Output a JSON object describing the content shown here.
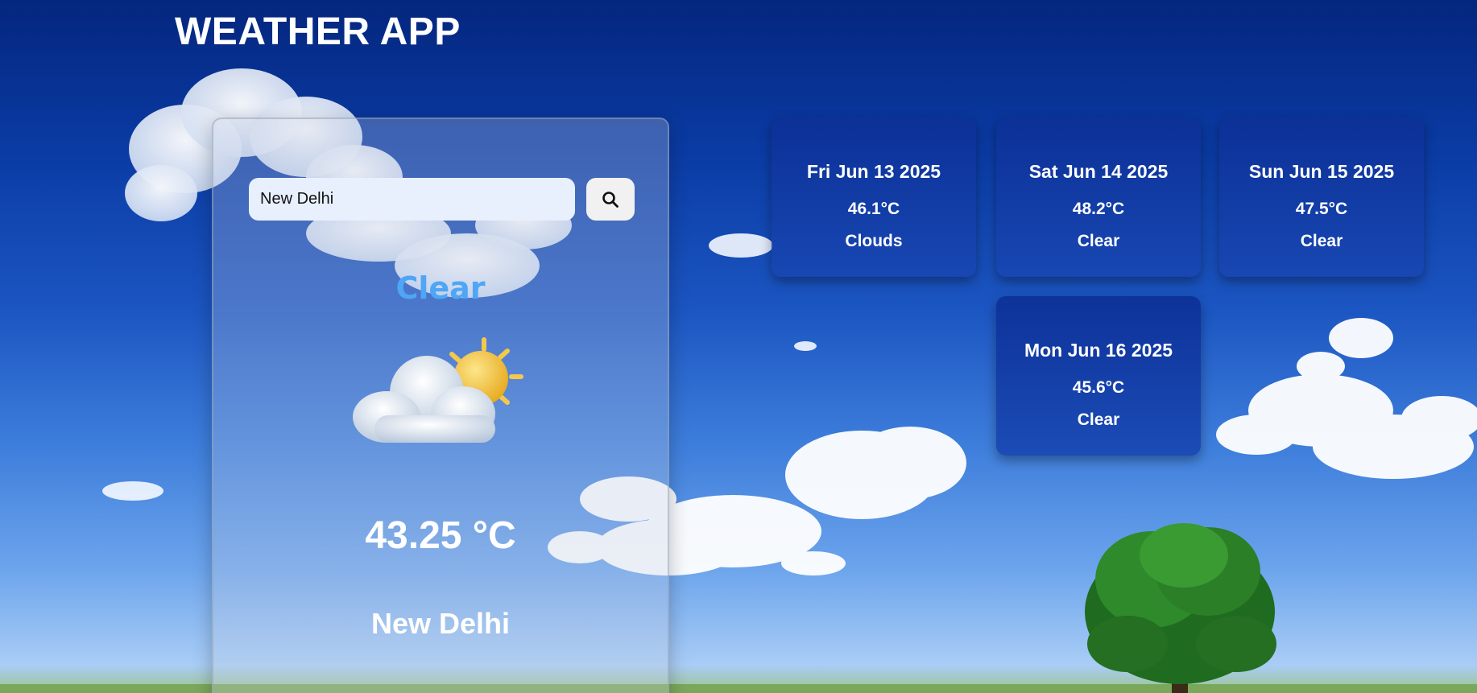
{
  "header": {
    "title": "WEATHER APP"
  },
  "current": {
    "search_value": "New Delhi",
    "search_icon": "search-icon",
    "condition": "Clear",
    "icon": "partly-cloudy-icon",
    "temperature": "43.25 °C",
    "city": "New Delhi"
  },
  "forecast": [
    {
      "date": "Fri Jun 13 2025",
      "temp": "46.1°C",
      "condition": "Clouds"
    },
    {
      "date": "Sat Jun 14 2025",
      "temp": "48.2°C",
      "condition": "Clear"
    },
    {
      "date": "Sun Jun 15 2025",
      "temp": "47.5°C",
      "condition": "Clear"
    },
    {
      "date": "Mon Jun 16 2025",
      "temp": "45.6°C",
      "condition": "Clear"
    }
  ],
  "colors": {
    "condition_accent": "#4ea6f5",
    "card_bg": "#1846b2"
  }
}
